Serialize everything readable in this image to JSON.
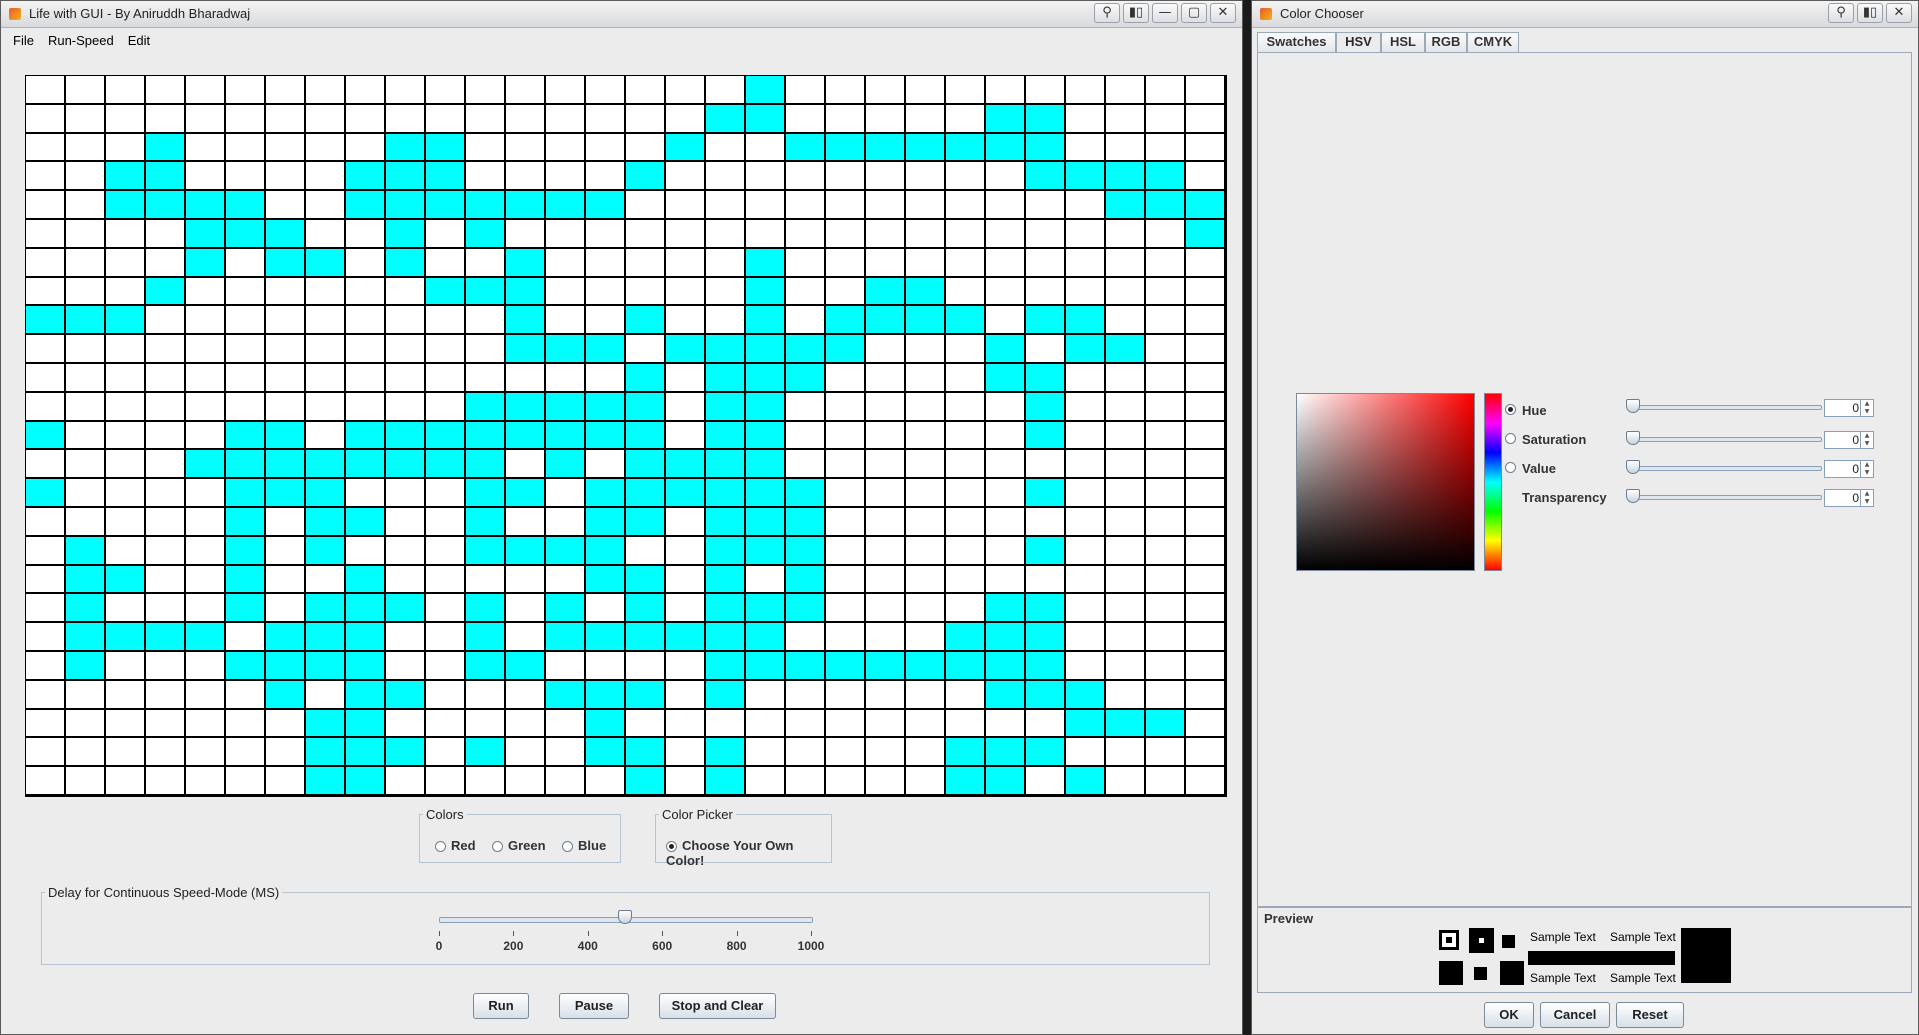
{
  "life_window": {
    "title": "Life with GUI - By Aniruddh Bharadwaj",
    "menu": [
      "File",
      "Run-Speed",
      "Edit"
    ],
    "grid": {
      "cols": 30,
      "rows": 25,
      "alive_color": "#00ffff",
      "dead_color": "#ffffff",
      "pattern": [
        "000000000000000000100000000000",
        "000000000000000001100000110000",
        "000100000110000010011111110000",
        "001100001110000100000000011110",
        "001111001111111000000000000111",
        "000011100101000000000000000001",
        "000010110100100000100000000000",
        "000100000011100000100110000000",
        "111000000000100100101111011000",
        "000000000000111011111000101100",
        "000000000000000101110000110000",
        "000000000001111101100000010000",
        "100001101111111101100000010000",
        "000011111111010111100000000000",
        "100001110001101111110000010000",
        "000001011001001101110000000000",
        "010001010001111001110000010000",
        "011001001000001101010000000000",
        "010001011101010101110000110000",
        "011110111001011111100001110000",
        "010001111001100001111111110000",
        "000000101100011101000000111000",
        "000000011000001000000000001110",
        "000000011101001101000001110000",
        "000000011000000101000001101000"
      ]
    },
    "colors_group": {
      "title": "Colors",
      "options": [
        {
          "label": "Red",
          "selected": false
        },
        {
          "label": "Green",
          "selected": false
        },
        {
          "label": "Blue",
          "selected": false
        }
      ]
    },
    "color_picker_group": {
      "title": "Color Picker",
      "option": {
        "label": "Choose Your Own Color!",
        "selected": true
      }
    },
    "delay_group": {
      "title": "Delay for Continuous Speed-Mode (MS)",
      "min": 0,
      "max": 1000,
      "value": 500,
      "ticks": [
        "0",
        "200",
        "400",
        "600",
        "800",
        "1000"
      ]
    },
    "buttons": {
      "run": "Run",
      "pause": "Pause",
      "stop": "Stop and Clear"
    }
  },
  "chooser_window": {
    "title": "Color Chooser",
    "tabs": [
      {
        "label": "Swatches",
        "active": false
      },
      {
        "label": "HSV",
        "active": true
      },
      {
        "label": "HSL",
        "active": false
      },
      {
        "label": "RGB",
        "active": false
      },
      {
        "label": "CMYK",
        "active": false
      }
    ],
    "hsv": {
      "hue": {
        "label": "Hue",
        "value": "0",
        "selected": true
      },
      "saturation": {
        "label": "Saturation",
        "value": "0",
        "selected": false
      },
      "value": {
        "label": "Value",
        "value": "0",
        "selected": false
      },
      "transparency": {
        "label": "Transparency",
        "value": "0"
      }
    },
    "preview": {
      "title": "Preview",
      "sample_text": "Sample Text",
      "color": "#000000"
    },
    "buttons": {
      "ok": "OK",
      "cancel": "Cancel",
      "reset": "Reset"
    }
  }
}
